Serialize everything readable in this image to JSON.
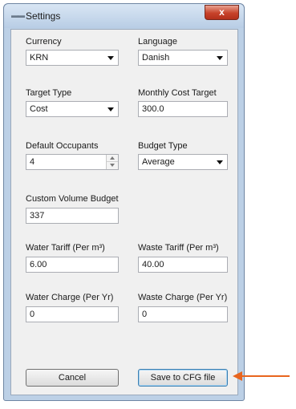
{
  "window": {
    "title": "Settings",
    "close_label": "x"
  },
  "currency": {
    "label": "Currency",
    "value": "KRN"
  },
  "language": {
    "label": "Language",
    "value": "Danish"
  },
  "target_type": {
    "label": "Target Type",
    "value": "Cost"
  },
  "monthly_cost_target": {
    "label": "Monthly Cost Target",
    "value": "300.0"
  },
  "default_occupants": {
    "label": "Default Occupants",
    "value": "4"
  },
  "budget_type": {
    "label": "Budget Type",
    "value": "Average"
  },
  "custom_volume_budget": {
    "label": "Custom Volume Budget",
    "value": "337"
  },
  "water_tariff": {
    "label": "Water Tariff (Per m³)",
    "value": "6.00"
  },
  "waste_tariff": {
    "label": "Waste Tariff (Per m³)",
    "value": "40.00"
  },
  "water_charge": {
    "label": "Water Charge (Per Yr)",
    "value": "0"
  },
  "waste_charge": {
    "label": "Waste Charge (Per Yr)",
    "value": "0"
  },
  "buttons": {
    "cancel": "Cancel",
    "save": "Save to CFG file"
  },
  "colors": {
    "annotation_arrow": "#e8651e",
    "window_frame": "#bcd0e6",
    "close_button": "#c7422a"
  }
}
